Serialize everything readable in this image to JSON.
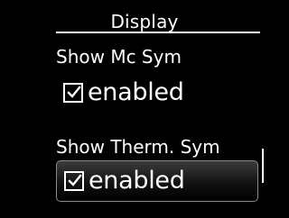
{
  "header": {
    "title": "Display"
  },
  "settings": [
    {
      "label": "Show Mc Sym",
      "value_label": "enabled",
      "checked": true,
      "focused": false
    },
    {
      "label": "Show Therm. Sym",
      "value_label": "enabled",
      "checked": true,
      "focused": true
    }
  ],
  "icons": {
    "checkbox": "checkbox-checked-icon"
  },
  "colors": {
    "background": "#000000",
    "text": "#ffffff",
    "focus_border": "#8a8a8a"
  }
}
